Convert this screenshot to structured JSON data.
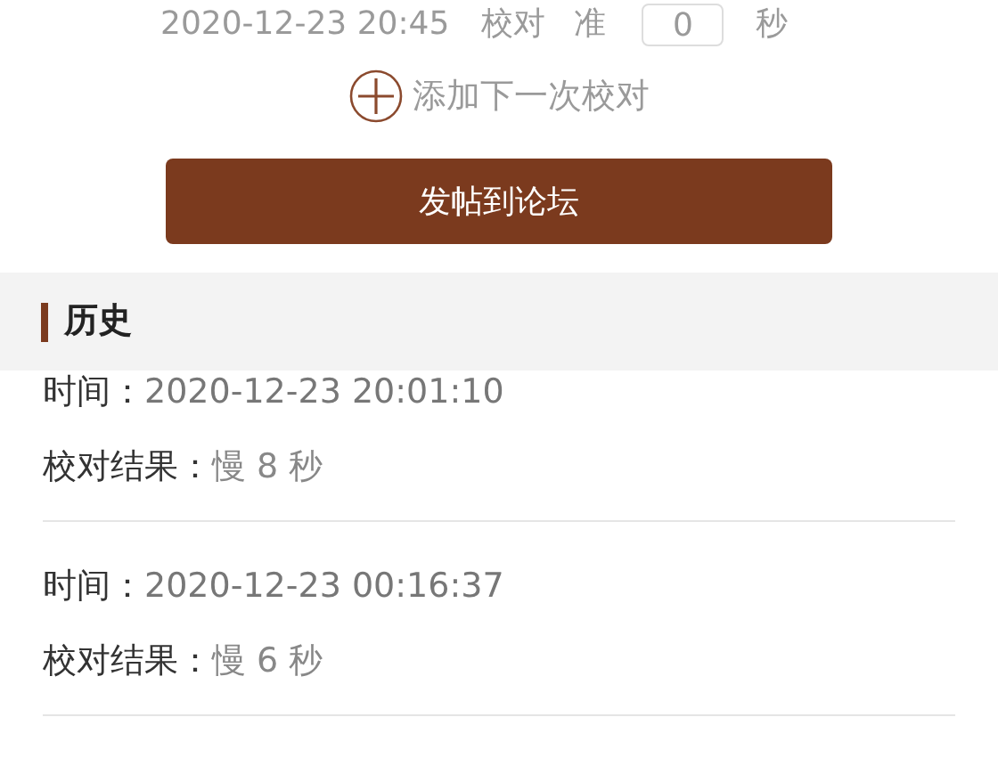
{
  "calibration": {
    "time": "2020-12-23 20:45",
    "label": "校对",
    "status": "准",
    "offset_value": "0",
    "unit": "秒"
  },
  "add_next": {
    "label": "添加下一次校对"
  },
  "post_button": {
    "label": "发帖到论坛"
  },
  "history": {
    "title": "历史",
    "records": [
      {
        "time_label": "时间：",
        "time": "2020-12-23 20:01:10",
        "result_label": "校对结果：",
        "result": "慢 8 秒"
      },
      {
        "time_label": "时间：",
        "time": "2020-12-23 00:16:37",
        "result_label": "校对结果：",
        "result": "慢 6 秒"
      }
    ]
  }
}
